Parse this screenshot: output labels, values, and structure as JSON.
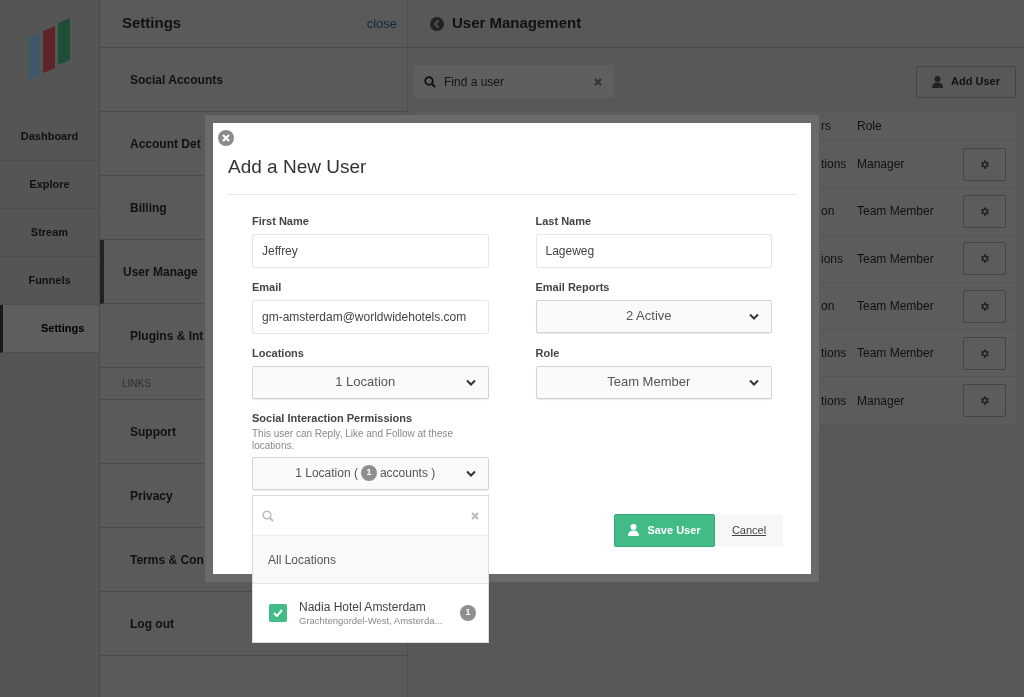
{
  "nav": {
    "items": [
      {
        "label": "Dashboard",
        "selected": false
      },
      {
        "label": "Explore",
        "selected": false
      },
      {
        "label": "Stream",
        "selected": false
      },
      {
        "label": "Funnels",
        "selected": false
      },
      {
        "label": "Settings",
        "selected": true
      }
    ]
  },
  "settings": {
    "title": "Settings",
    "close": "close",
    "items": [
      {
        "label": "Social Accounts",
        "selected": false
      },
      {
        "label": "Account Det",
        "selected": false
      },
      {
        "label": "Billing",
        "selected": false
      },
      {
        "label": "User Manage",
        "selected": true
      },
      {
        "label": "Plugins & Int",
        "selected": false
      }
    ],
    "links_heading": "LINKS",
    "links": [
      "Support",
      "Privacy",
      "Terms & Con",
      "Log out"
    ]
  },
  "main": {
    "title": "User Management",
    "search": {
      "placeholder": "Find a user"
    },
    "add_button": "Add User",
    "table": {
      "columns": [
        "rs",
        "Role"
      ],
      "rows": [
        {
          "cells": [
            "tions",
            "Manager"
          ]
        },
        {
          "cells": [
            "on",
            "Team Member"
          ]
        },
        {
          "cells": [
            "ions",
            "Team Member"
          ]
        },
        {
          "cells": [
            "on",
            "Team Member"
          ]
        },
        {
          "cells": [
            "tions",
            "Team Member"
          ]
        },
        {
          "cells": [
            "tions",
            "Manager"
          ]
        }
      ]
    }
  },
  "modal": {
    "title": "Add a New User",
    "fields": [
      {
        "kind": "text",
        "label": "First Name",
        "value": "Jeffrey"
      },
      {
        "kind": "text",
        "label": "Last Name",
        "value": "Lageweg"
      },
      {
        "kind": "text",
        "label": "Email",
        "value": "gm-amsterdam@worldwidehotels.com"
      },
      {
        "kind": "select",
        "label": "Email Reports",
        "value": "2 Active"
      },
      {
        "kind": "select",
        "label": "Locations",
        "value": "1 Location"
      },
      {
        "kind": "select",
        "label": "Role",
        "value": "Team Member"
      }
    ],
    "permissions": {
      "label": "Social Interaction Permissions",
      "description": "This user can Reply, Like and Follow at these locations.",
      "select": {
        "before": "1 Location (",
        "badge": "1",
        "after": "accounts )"
      },
      "dropdown": {
        "all": "All Locations",
        "options": [
          {
            "name": "Nadia Hotel Amsterdam",
            "address": "Grachtengordel-West, Amsterda...",
            "count": "1",
            "checked": true
          }
        ]
      }
    },
    "save": "Save User",
    "cancel": "Cancel"
  }
}
